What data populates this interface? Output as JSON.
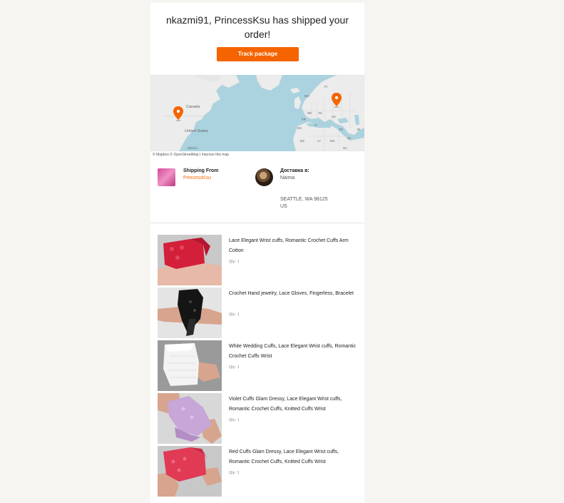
{
  "header": {
    "headline": "nkazmi91, PrincessKsu has shipped your order!",
    "track_button_label": "Track package"
  },
  "map": {
    "labels": {
      "canada": "Canada",
      "united_states": "United States",
      "mexico": "Mexico",
      "no": "NO",
      "fi": "FI",
      "de": "DE",
      "pl": "PL",
      "fr": "FR",
      "ua": "UA",
      "es": "ES",
      "it": "IT",
      "tr": "TR",
      "dz": "DZ",
      "ly": "LY",
      "eg": "EG",
      "sa": "SA",
      "iq": "IQ",
      "ir": "IR"
    },
    "attribution": {
      "mapbox": "© Mapbox",
      "osm": "© OpenStreetMap",
      "separator": "|",
      "improve": "Improve this map"
    },
    "colors": {
      "water": "#aad3df",
      "land": "#ececec",
      "pin": "#f56400"
    }
  },
  "shipping_from": {
    "label": "Shipping From",
    "shop": "PrincessKsu"
  },
  "destination": {
    "label": "Доставка в:",
    "name": "Naima",
    "address_line1": "SEATTLE, WA 98125",
    "address_line2": "US"
  },
  "items": [
    {
      "title": "Lace Elegant Wrist cuffs, Romantic Crochet Cuffs Arm Cotton",
      "qty": "Qty: 1",
      "colors": {
        "bg": "#c9c9c9",
        "cuff": "#d31f3a"
      }
    },
    {
      "title": "Crochet Hand jewelry, Lace Gloves, Fingerless, Bracelet",
      "qty": "Qty: 1",
      "colors": {
        "bg": "#e4e4e4",
        "cuff": "#151515"
      }
    },
    {
      "title": "White Wedding Cuffs, Lace Elegant Wrist cuffs, Romantic Crochet Cuffs Wrist",
      "qty": "Qty: 1",
      "colors": {
        "bg": "#9a9a9a",
        "cuff": "#f3f3f3"
      }
    },
    {
      "title": "Violet Cuffs Glam Dressy, Lace Elegant Wrist cuffs, Romantic Crochet Cuffs, Knitted Cuffs Wrist",
      "qty": "Qty: 1",
      "colors": {
        "bg": "#d8d8d8",
        "cuff": "#c7a6d8"
      }
    },
    {
      "title": "Red Cuffs Glam Dressy, Lace Elegant Wrist cuffs, Romantic Crochet Cuffs, Knitted Cuffs Wrist",
      "qty": "Qty: 1",
      "colors": {
        "bg": "#c8c8c8",
        "cuff": "#e03a55"
      }
    }
  ]
}
